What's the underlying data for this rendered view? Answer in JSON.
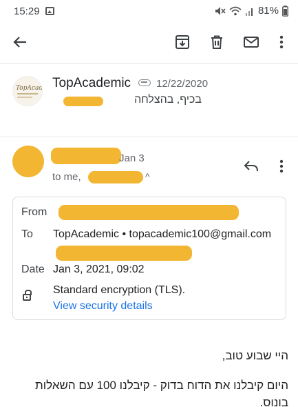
{
  "status_bar": {
    "time": "15:29",
    "battery": "81%",
    "icons": [
      "gallery-icon",
      "mute-icon",
      "wifi-icon",
      "signal-icon",
      "battery-icon"
    ]
  },
  "app_bar": {
    "icons": [
      "back-arrow-icon",
      "archive-icon",
      "delete-icon",
      "mail-icon",
      "more-vert-icon"
    ]
  },
  "thread": {
    "sender": "TopAcademic",
    "date": "12/22/2020",
    "preview": "בכיף, בהצלחה",
    "logo_text": "TopAcademic"
  },
  "message": {
    "date": "Jan 3",
    "to_line": "to me,",
    "caret": "^",
    "actions": [
      "reply-icon",
      "more-vert-icon"
    ]
  },
  "details": {
    "from_label": "From",
    "to_label": "To",
    "to_value": "TopAcademic • topacademic100@gmail.com",
    "date_label": "Date",
    "date_value": "Jan 3, 2021, 09:02",
    "encryption": "Standard encryption (TLS).",
    "security_link": "View security details"
  },
  "body": {
    "line1": "היי שבוע טוב,",
    "line2": "היום קיבלנו את הדוח בדוק - קיבלנו 100 עם השאלות בונוס."
  },
  "colors": {
    "redaction": "#f2b632",
    "link": "#1a73e8",
    "text": "#202124",
    "secondary": "#5f6368"
  }
}
